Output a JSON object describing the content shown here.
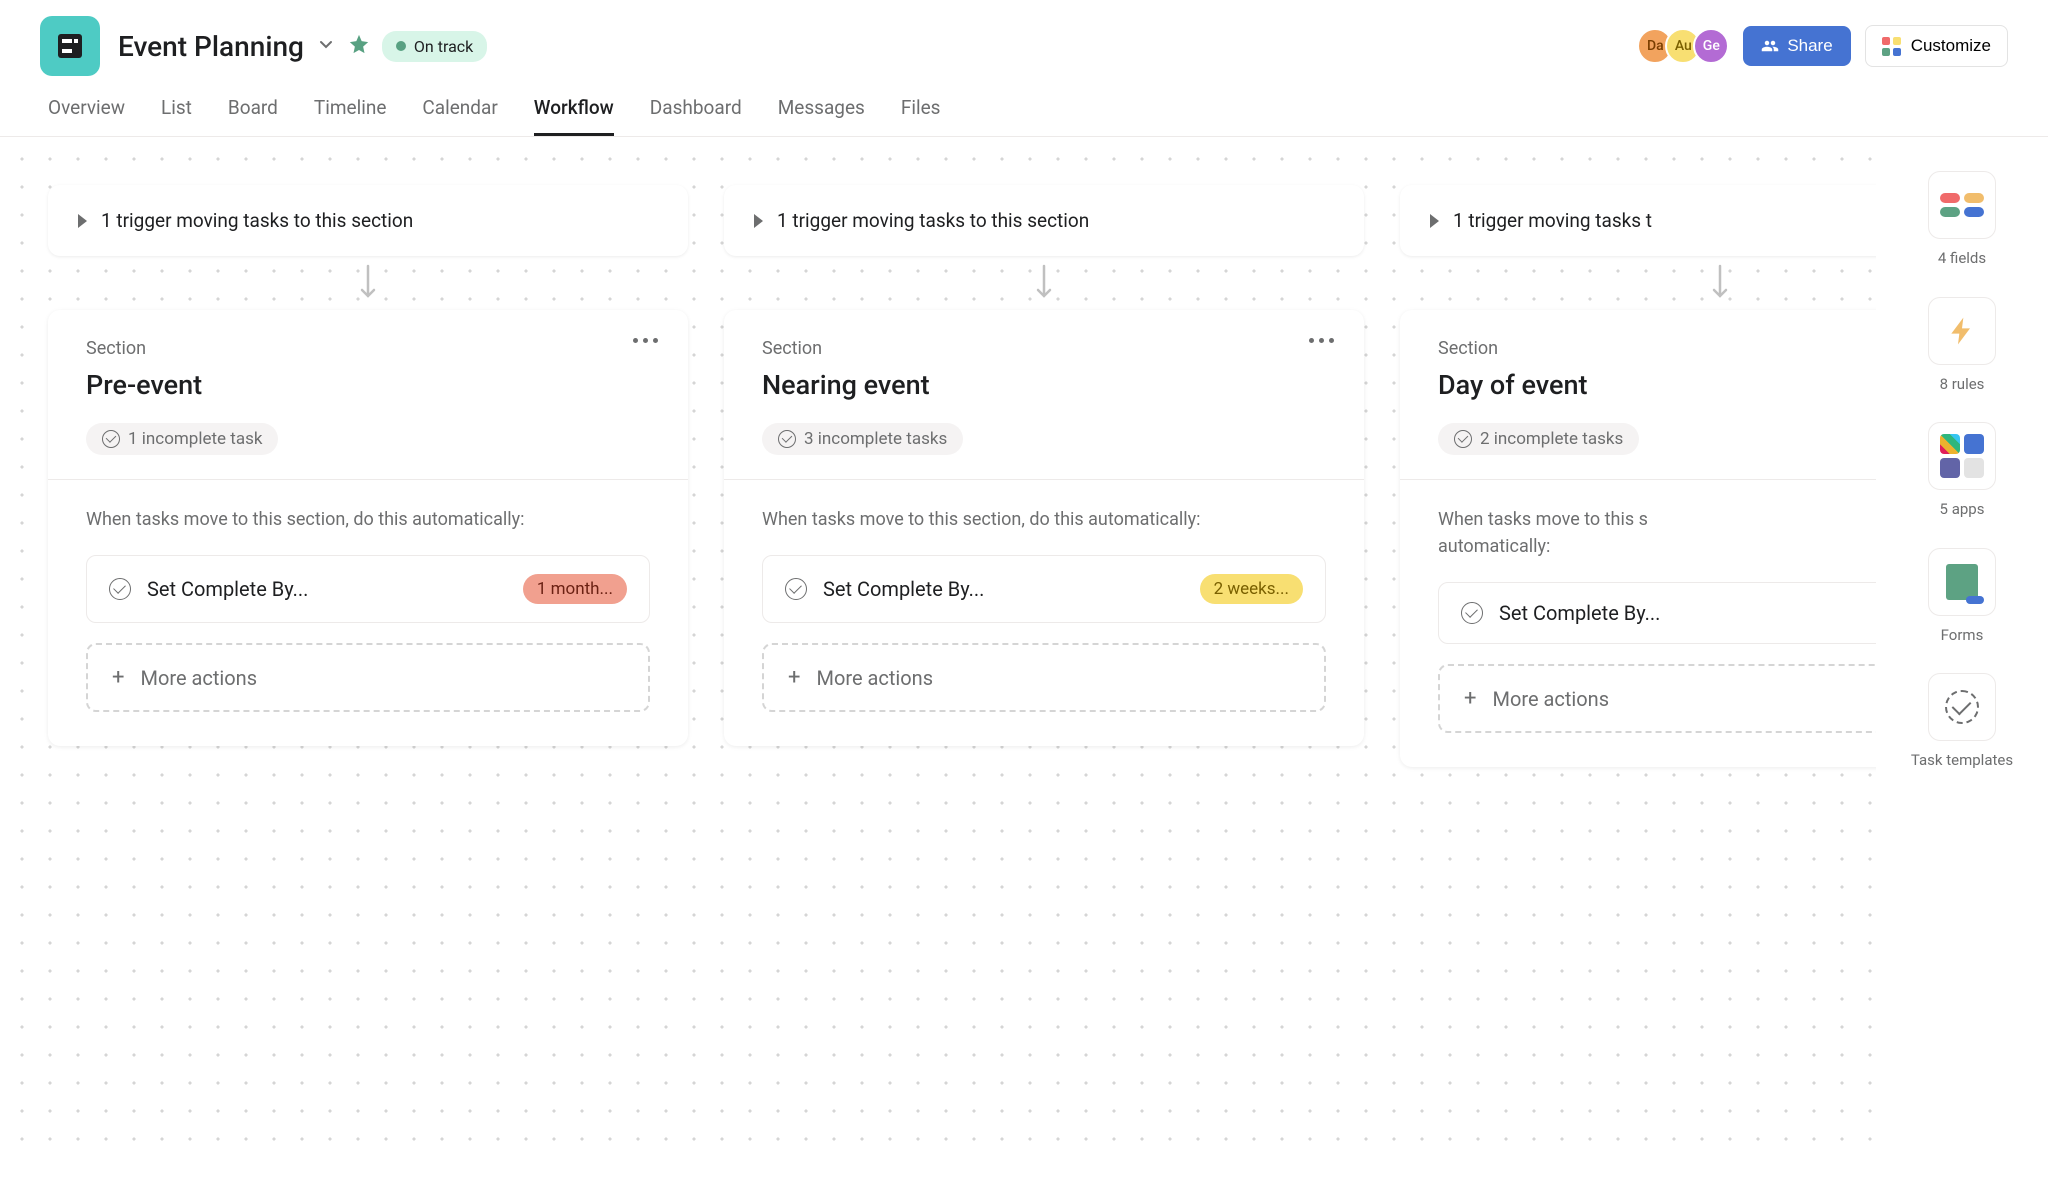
{
  "project": {
    "title": "Event Planning",
    "status": "On track"
  },
  "avatars": [
    "Da",
    "Au",
    "Ge"
  ],
  "buttons": {
    "share": "Share",
    "customize": "Customize"
  },
  "tabs": [
    "Overview",
    "List",
    "Board",
    "Timeline",
    "Calendar",
    "Workflow",
    "Dashboard",
    "Messages",
    "Files"
  ],
  "active_tab": "Workflow",
  "columns": [
    {
      "trigger": "1 trigger moving tasks to this section",
      "section_label": "Section",
      "name": "Pre-event",
      "incomplete": "1 incomplete task",
      "body_label": "When tasks move to this section, do this automatically:",
      "rule_text": "Set Complete By...",
      "rule_badge": "1 month...",
      "badge_class": "badge-orange",
      "more_actions": "More actions"
    },
    {
      "trigger": "1 trigger moving tasks to this section",
      "section_label": "Section",
      "name": "Nearing event",
      "incomplete": "3 incomplete tasks",
      "body_label": "When tasks move to this section, do this automatically:",
      "rule_text": "Set Complete By...",
      "rule_badge": "2 weeks...",
      "badge_class": "badge-yellow",
      "more_actions": "More actions"
    },
    {
      "trigger": "1 trigger moving tasks t",
      "section_label": "Section",
      "name": "Day of event",
      "incomplete": "2 incomplete tasks",
      "body_label": "When tasks move to this s",
      "body_label2": "automatically:",
      "rule_text": "Set Complete By...",
      "rule_badge": "",
      "badge_class": "",
      "more_actions": "More actions"
    }
  ],
  "sidebar": {
    "fields": "4 fields",
    "rules": "8 rules",
    "apps": "5 apps",
    "forms": "Forms",
    "templates": "Task templates"
  }
}
